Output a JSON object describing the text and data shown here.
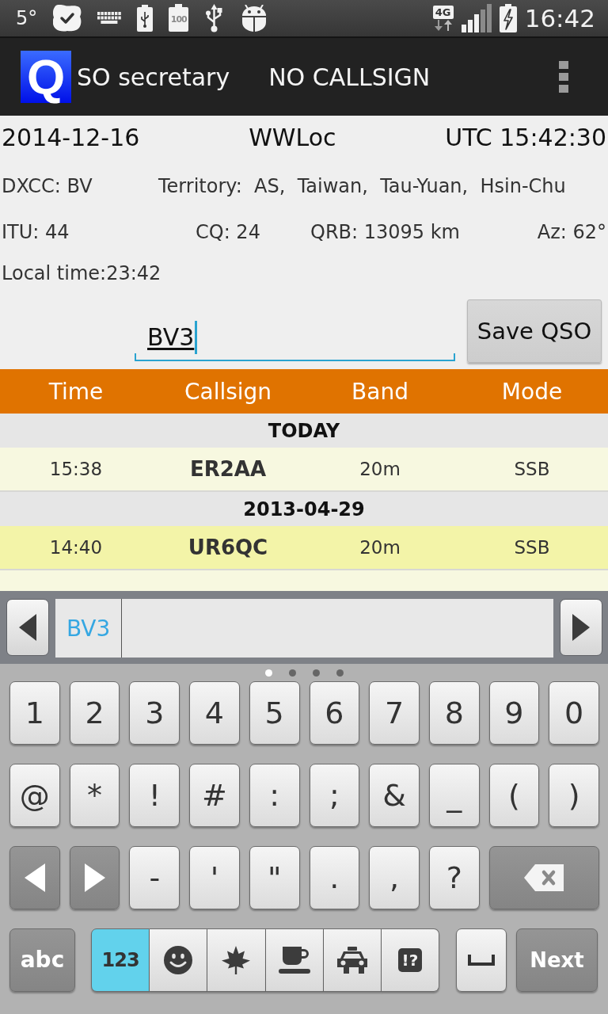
{
  "status_bar": {
    "temperature": "5°",
    "battery_level": "100",
    "network_type": "4G",
    "time": "16:42"
  },
  "app_bar": {
    "logo_letter": "Q",
    "title": "SO secretary",
    "callsign": "NO CALLSIGN"
  },
  "info": {
    "date": "2014-12-16",
    "locator": "WWLoc",
    "utc": "UTC 15:42:30",
    "dxcc": "DXCC: BV",
    "territory": "Territory:  AS,  Taiwan,  Tau-Yuan,  Hsin-Chu",
    "itu": "ITU: 44",
    "cq": "CQ: 24",
    "qrb": "QRB: 13095 km",
    "azimuth": "Az: 62°",
    "local_time": "Local time:23:42"
  },
  "entry": {
    "value": "BV3",
    "focused": true,
    "composing": true,
    "button": "Save QSO"
  },
  "log": {
    "columns": [
      "Time",
      "Callsign",
      "Band",
      "Mode"
    ],
    "groups": [
      {
        "date": "TODAY",
        "rows": [
          {
            "time": "15:38",
            "callsign": "ER2AA",
            "band": "20m",
            "mode": "SSB",
            "selected": false
          }
        ]
      },
      {
        "date": "2013-04-29",
        "rows": [
          {
            "time": "14:40",
            "callsign": "UR6QC",
            "band": "20m",
            "mode": "SSB",
            "selected": true
          }
        ]
      }
    ]
  },
  "keyboard": {
    "candidates": [
      "BV3"
    ],
    "page_dots": [
      {
        "selected": true
      },
      {
        "selected": false
      },
      {
        "selected": false
      },
      {
        "selected": false
      }
    ],
    "rows": [
      [
        {
          "kind": "char",
          "label": "1"
        },
        {
          "kind": "char",
          "label": "2"
        },
        {
          "kind": "char",
          "label": "3"
        },
        {
          "kind": "char",
          "label": "4"
        },
        {
          "kind": "char",
          "label": "5"
        },
        {
          "kind": "char",
          "label": "6"
        },
        {
          "kind": "char",
          "label": "7"
        },
        {
          "kind": "char",
          "label": "8"
        },
        {
          "kind": "char",
          "label": "9"
        },
        {
          "kind": "char",
          "label": "0"
        }
      ],
      [
        {
          "kind": "char",
          "label": "@"
        },
        {
          "kind": "char",
          "label": "*"
        },
        {
          "kind": "char",
          "label": "!"
        },
        {
          "kind": "char",
          "label": "#"
        },
        {
          "kind": "char",
          "label": ":"
        },
        {
          "kind": "char",
          "label": ";"
        },
        {
          "kind": "char",
          "label": "&"
        },
        {
          "kind": "char",
          "label": "_"
        },
        {
          "kind": "char",
          "label": "("
        },
        {
          "kind": "char",
          "label": ")"
        }
      ],
      [
        {
          "kind": "left"
        },
        {
          "kind": "right"
        },
        {
          "kind": "char",
          "label": "-"
        },
        {
          "kind": "char",
          "label": "'"
        },
        {
          "kind": "char",
          "label": "\""
        },
        {
          "kind": "char",
          "label": "."
        },
        {
          "kind": "char",
          "label": ","
        },
        {
          "kind": "char",
          "label": "?"
        },
        {
          "kind": "delete"
        }
      ]
    ],
    "mode_key": "abc",
    "categories": [
      {
        "kind": "text",
        "label": "123",
        "selected": true
      },
      {
        "kind": "icon",
        "selected": false
      },
      {
        "kind": "icon",
        "selected": false
      },
      {
        "kind": "icon",
        "selected": false
      },
      {
        "kind": "icon",
        "selected": false
      },
      {
        "kind": "badge",
        "label": "!?",
        "selected": false
      }
    ],
    "action_key": "Next"
  }
}
